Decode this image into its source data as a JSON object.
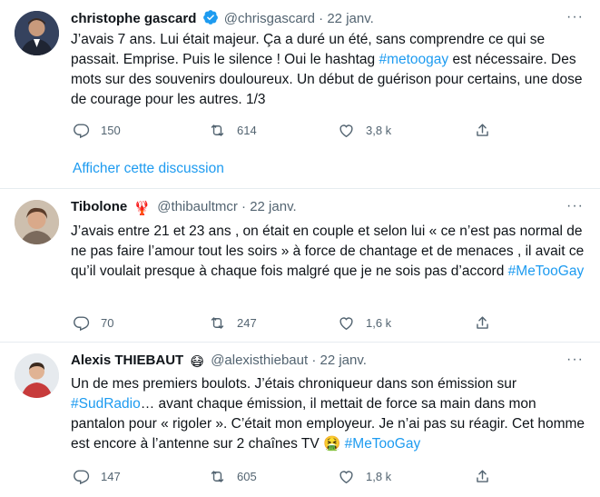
{
  "tweets": [
    {
      "name": "christophe gascard",
      "handle": "@chrisgascard",
      "dot": "·",
      "date": "22 janv.",
      "verified": true,
      "text_parts": [
        "J’avais 7 ans. Lui était majeur. Ça a duré un été, sans comprendre ce qui se passait. Emprise. Puis le silence ! Oui le hashtag ",
        "#metoogay",
        " est nécessaire. Des mots sur des souvenirs douloureux. Un début de guérison pour certains, une dose de courage pour les autres. 1/3"
      ],
      "replies": "150",
      "retweets": "614",
      "likes": "3,8 k",
      "thread_link": "Afficher cette discussion"
    },
    {
      "name": "Tibolone",
      "emoji": "🦞",
      "handle": "@thibaultmcr",
      "dot": "·",
      "date": "22 janv.",
      "text_parts": [
        "J’avais entre 21 et 23 ans , on était en couple et selon lui « ce n’est pas normal de ne pas faire l’amour tout les soirs » à force de chantage et de menaces , il avait ce qu’il voulait presque à chaque fois malgré que je ne sois pas d’accord ",
        "#MeTooGay"
      ],
      "replies": "70",
      "retweets": "247",
      "likes": "1,6 k"
    },
    {
      "name": "Alexis THIEBAUT",
      "emoji": "😷",
      "handle": "@alexisthiebaut",
      "dot": "·",
      "date": "22 janv.",
      "text_parts": [
        "Un de mes premiers boulots. J’étais chroniqueur dans son émission sur ",
        "#SudRadio",
        "… avant chaque émission, il mettait de force sa main dans mon pantalon pour « rigoler ». C’était mon employeur. Je n’ai pas su réagir. Cet homme est encore à l’antenne sur 2 chaînes TV ",
        "🤮",
        " ",
        "#MeTooGay"
      ],
      "replies": "147",
      "retweets": "605",
      "likes": "1,8 k"
    }
  ],
  "icons": {
    "more": "more-icon",
    "reply": "reply-icon",
    "retweet": "retweet-icon",
    "like": "heart-icon",
    "share": "share-icon",
    "verified": "verified-badge-icon"
  },
  "colors": {
    "accent": "#1d9bf0",
    "muted": "#536471",
    "text": "#0f1419",
    "divider": "#e6ecf0"
  }
}
